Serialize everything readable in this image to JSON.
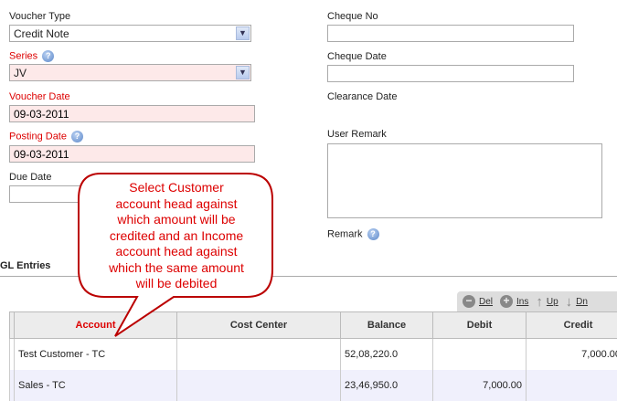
{
  "form": {
    "voucher_type": {
      "label": "Voucher Type",
      "value": "Credit Note"
    },
    "series": {
      "label": "Series",
      "value": "JV"
    },
    "voucher_date": {
      "label": "Voucher Date",
      "value": "09-03-2011"
    },
    "posting_date": {
      "label": "Posting Date",
      "value": "09-03-2011"
    },
    "due_date": {
      "label": "Due Date",
      "value": ""
    },
    "cheque_no": {
      "label": "Cheque No",
      "value": ""
    },
    "cheque_date": {
      "label": "Cheque Date",
      "value": ""
    },
    "clearance_date": {
      "label": "Clearance Date"
    },
    "user_remark": {
      "label": "User Remark",
      "value": ""
    },
    "remark": {
      "label": "Remark"
    }
  },
  "help_glyph": "?",
  "callout": {
    "lines": [
      "Select Customer",
      "account head against",
      "which amount will be",
      "credited and an Income",
      "account head against",
      "which the same amount",
      "will be debited"
    ]
  },
  "gl": {
    "title": "GL Entries",
    "toolbar": {
      "del": "Del",
      "ins": "Ins",
      "up": "Up",
      "down": "Dn"
    },
    "columns": [
      "Account",
      "Cost Center",
      "Balance",
      "Debit",
      "Credit"
    ],
    "rows": [
      {
        "account": "Test Customer - TC",
        "cost_center": "",
        "balance": "52,08,220.0",
        "debit": "",
        "credit": "7,000.00"
      },
      {
        "account": "Sales - TC",
        "cost_center": "",
        "balance": "23,46,950.0",
        "debit": "7,000.00",
        "credit": ""
      }
    ]
  }
}
